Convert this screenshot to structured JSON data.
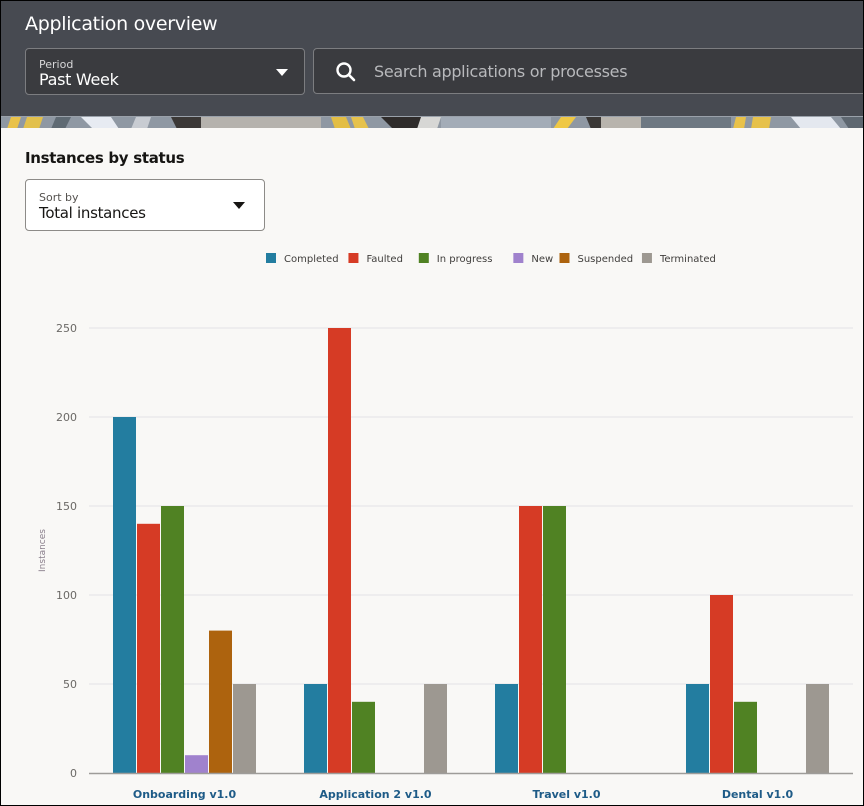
{
  "header": {
    "title": "Application overview",
    "period": {
      "label": "Period",
      "value": "Past Week"
    },
    "search": {
      "placeholder": "Search applications or processes",
      "value": ""
    }
  },
  "section": {
    "title": "Instances by status",
    "sort": {
      "label": "Sort by",
      "value": "Total instances"
    }
  },
  "chart_data": {
    "type": "bar",
    "title": "",
    "xlabel": "",
    "ylabel": "Instances",
    "ylim": [
      0,
      250
    ],
    "yticks": [
      0,
      50,
      100,
      150,
      200,
      250
    ],
    "grid": true,
    "legend_position": "top-center",
    "categories": [
      "Onboarding v1.0",
      "Application 2 v1.0",
      "Travel v1.0",
      "Dental v1.0"
    ],
    "series": [
      {
        "name": "Completed",
        "color": "#237da0",
        "values": [
          200,
          50,
          50,
          50
        ]
      },
      {
        "name": "Faulted",
        "color": "#d63b25",
        "values": [
          140,
          250,
          150,
          100
        ]
      },
      {
        "name": "In progress",
        "color": "#508223",
        "values": [
          150,
          40,
          150,
          40
        ]
      },
      {
        "name": "New",
        "color": "#a082cd",
        "values": [
          10,
          0,
          0,
          0
        ]
      },
      {
        "name": "Suspended",
        "color": "#ad630e",
        "values": [
          80,
          0,
          0,
          0
        ]
      },
      {
        "name": "Terminated",
        "color": "#9d9891",
        "values": [
          50,
          50,
          0,
          50
        ]
      }
    ]
  }
}
